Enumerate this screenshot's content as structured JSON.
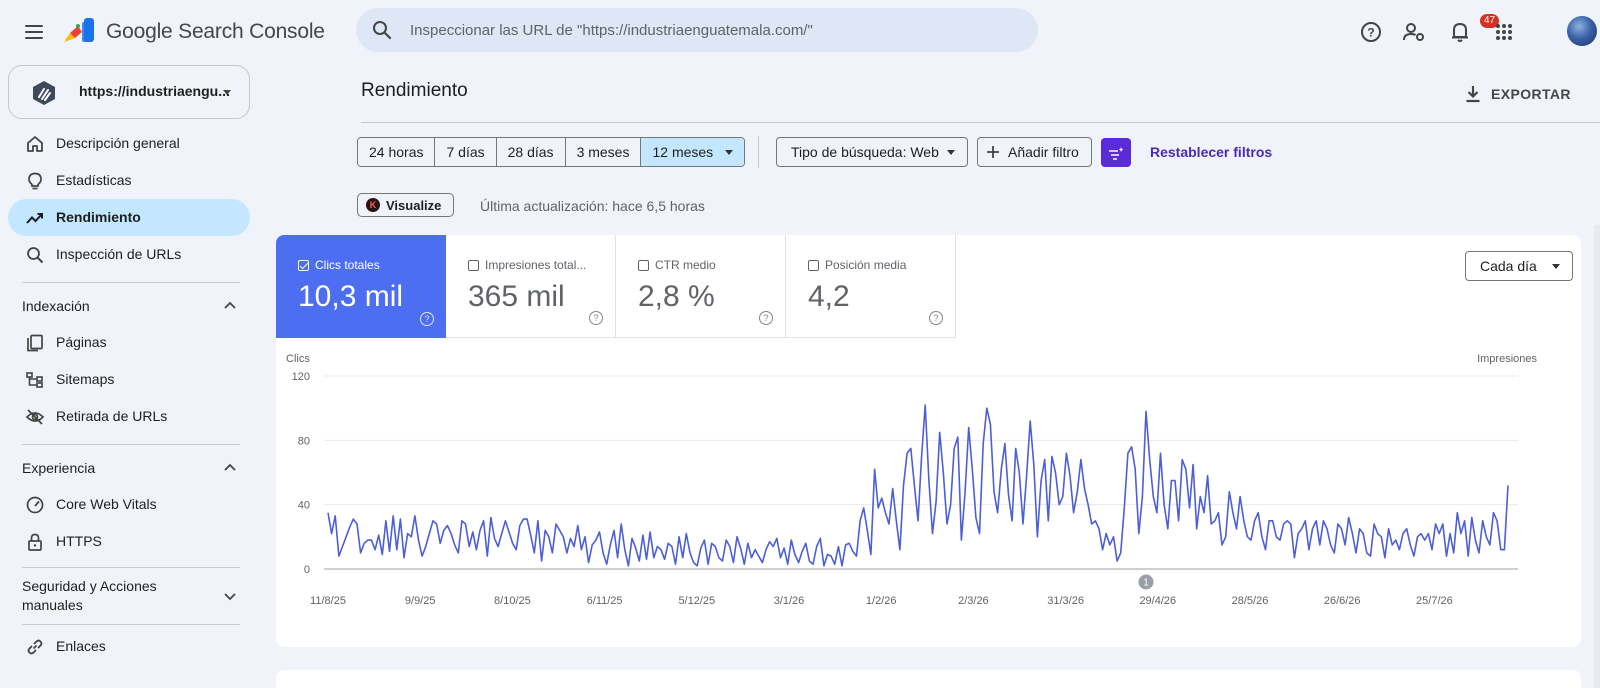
{
  "app": {
    "brand": "Google Search Console",
    "search_placeholder": "Inspeccionar las URL de \"https://industriaenguatemala.com/\"",
    "notifications_count": "47"
  },
  "sidebar": {
    "property": "https://industriaengu...",
    "items_top": [
      {
        "label": "Descripción general",
        "icon": "home-icon"
      },
      {
        "label": "Estadísticas",
        "icon": "lightbulb-icon"
      },
      {
        "label": "Rendimiento",
        "icon": "trending-up-icon",
        "active": true
      },
      {
        "label": "Inspección de URLs",
        "icon": "search-icon"
      }
    ],
    "sections": [
      {
        "label": "Indexación",
        "expanded": true,
        "items": [
          {
            "label": "Páginas",
            "icon": "pages-icon"
          },
          {
            "label": "Sitemaps",
            "icon": "sitemap-icon"
          },
          {
            "label": "Retirada de URLs",
            "icon": "eye-off-icon"
          }
        ]
      },
      {
        "label": "Experiencia",
        "expanded": true,
        "items": [
          {
            "label": "Core Web Vitals",
            "icon": "gauge-icon"
          },
          {
            "label": "HTTPS",
            "icon": "lock-icon"
          }
        ]
      },
      {
        "label": "Seguridad y Acciones manuales",
        "label_line1": "Seguridad y Acciones",
        "label_line2": "manuales",
        "expanded": false,
        "items": []
      }
    ],
    "items_bottom": [
      {
        "label": "Enlaces",
        "icon": "link-icon"
      }
    ]
  },
  "main": {
    "title": "Rendimiento",
    "export_label": "EXPORTAR",
    "ranges": [
      "24 horas",
      "7 días",
      "28 días",
      "3 meses",
      "12 meses"
    ],
    "selected_range": "12 meses",
    "search_type": "Tipo de búsqueda: Web",
    "add_filter": "Añadir filtro",
    "reset_filters": "Restablecer filtros",
    "visualize": "Visualize",
    "last_update": "Última actualización: hace 6,5 horas",
    "granularity": "Cada día",
    "metrics": [
      {
        "label": "Clics totales",
        "value": "10,3 mil",
        "checked": true
      },
      {
        "label": "Impresiones total...",
        "value": "365 mil",
        "checked": false
      },
      {
        "label": "CTR medio",
        "value": "2,8 %",
        "checked": false
      },
      {
        "label": "Posición media",
        "value": "4,2",
        "checked": false
      }
    ],
    "annotation_marker": "1",
    "colors": {
      "accent": "#4e6ef2",
      "active_nav": "#c2e7ff",
      "line": "#4c5fd5",
      "filter_btn": "#5b2bd8"
    }
  },
  "chart_data": {
    "type": "line",
    "ylabel_left": "Clics",
    "ylabel_right": "Impresiones",
    "ylim": [
      0,
      120
    ],
    "yticks": [
      0,
      40,
      80,
      120
    ],
    "xticks": [
      "11/8/25",
      "9/9/25",
      "8/10/25",
      "6/11/25",
      "5/12/25",
      "3/1/26",
      "1/2/26",
      "2/3/26",
      "31/3/26",
      "29/4/26",
      "28/5/26",
      "26/6/26",
      "25/7/26"
    ],
    "x_start": "11/8/25",
    "x_end": "10/8/26",
    "grid": true,
    "series": [
      {
        "name": "Clics totales",
        "values": [
          35,
          22,
          33,
          8,
          14,
          20,
          26,
          31,
          28,
          10,
          16,
          18,
          18,
          12,
          21,
          9,
          30,
          11,
          33,
          12,
          31,
          7,
          22,
          20,
          33,
          18,
          8,
          14,
          22,
          30,
          28,
          16,
          24,
          27,
          22,
          15,
          10,
          30,
          28,
          14,
          23,
          12,
          24,
          30,
          8,
          32,
          19,
          14,
          22,
          30,
          23,
          16,
          12,
          27,
          31,
          31,
          21,
          10,
          30,
          5,
          24,
          20,
          10,
          28,
          24,
          20,
          10,
          19,
          14,
          27,
          12,
          20,
          4,
          15,
          18,
          23,
          10,
          3,
          15,
          24,
          7,
          28,
          12,
          2,
          19,
          13,
          5,
          21,
          6,
          23,
          7,
          14,
          12,
          6,
          16,
          14,
          3,
          20,
          7,
          22,
          10,
          4,
          2,
          13,
          18,
          3,
          16,
          14,
          7,
          5,
          18,
          14,
          4,
          20,
          13,
          3,
          16,
          7,
          12,
          8,
          4,
          12,
          17,
          14,
          19,
          7,
          13,
          3,
          18,
          9,
          4,
          11,
          16,
          5,
          3,
          14,
          19,
          2,
          9,
          8,
          3,
          14,
          2,
          15,
          16,
          11,
          8,
          30,
          38,
          24,
          9,
          62,
          38,
          44,
          35,
          28,
          50,
          30,
          12,
          52,
          72,
          75,
          52,
          30,
          70,
          102,
          55,
          22,
          42,
          85,
          60,
          28,
          40,
          75,
          82,
          18,
          48,
          88,
          62,
          32,
          22,
          78,
          100,
          90,
          48,
          35,
          62,
          78,
          46,
          30,
          75,
          60,
          28,
          58,
          92,
          65,
          20,
          55,
          68,
          30,
          70,
          60,
          40,
          45,
          72,
          58,
          35,
          48,
          68,
          50,
          40,
          28,
          30,
          25,
          12,
          22,
          15,
          20,
          5,
          10,
          38,
          72,
          76,
          62,
          22,
          45,
          98,
          68,
          45,
          35,
          72,
          40,
          25,
          55,
          55,
          30,
          68,
          62,
          38,
          65,
          25,
          45,
          35,
          58,
          28,
          30,
          35,
          15,
          20,
          48,
          35,
          25,
          45,
          30,
          20,
          18,
          30,
          35,
          20,
          12,
          30,
          30,
          20,
          18,
          28,
          30,
          28,
          7,
          22,
          25,
          30,
          12,
          25,
          30,
          15,
          30,
          25,
          15,
          10,
          28,
          25,
          15,
          32,
          22,
          10,
          25,
          22,
          10,
          8,
          28,
          22,
          20,
          7,
          25,
          15,
          18,
          12,
          22,
          25,
          15,
          8,
          20,
          22,
          18,
          22,
          12,
          28,
          22,
          28,
          8,
          22,
          10,
          35,
          22,
          30,
          8,
          32,
          18,
          10,
          30,
          20,
          15,
          35,
          30,
          12,
          12,
          52
        ]
      }
    ]
  }
}
